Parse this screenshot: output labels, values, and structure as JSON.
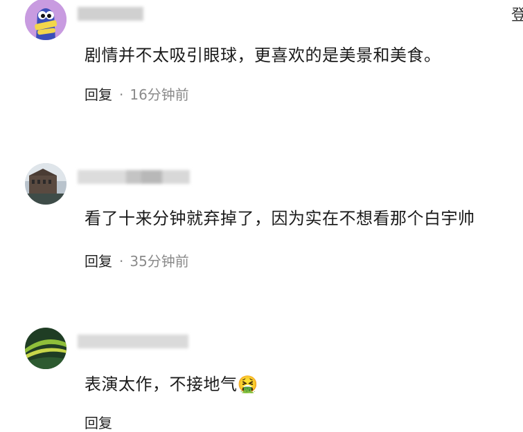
{
  "corner_text": "登",
  "comments": [
    {
      "text": "剧情并不太吸引眼球，更喜欢的是美景和美食。",
      "reply_label": "回复",
      "time": "16分钟前"
    },
    {
      "text": "看了十来分钟就弃掉了，因为实在不想看那个白宇帅",
      "reply_label": "回复",
      "time": "35分钟前"
    },
    {
      "text": "表演太作，不接地气",
      "reply_label": "回复",
      "time": "",
      "emoji": "🤮"
    }
  ],
  "colors": {
    "avatar1_bg": "#c89be0",
    "blur_gray": "#d2d2d2"
  }
}
